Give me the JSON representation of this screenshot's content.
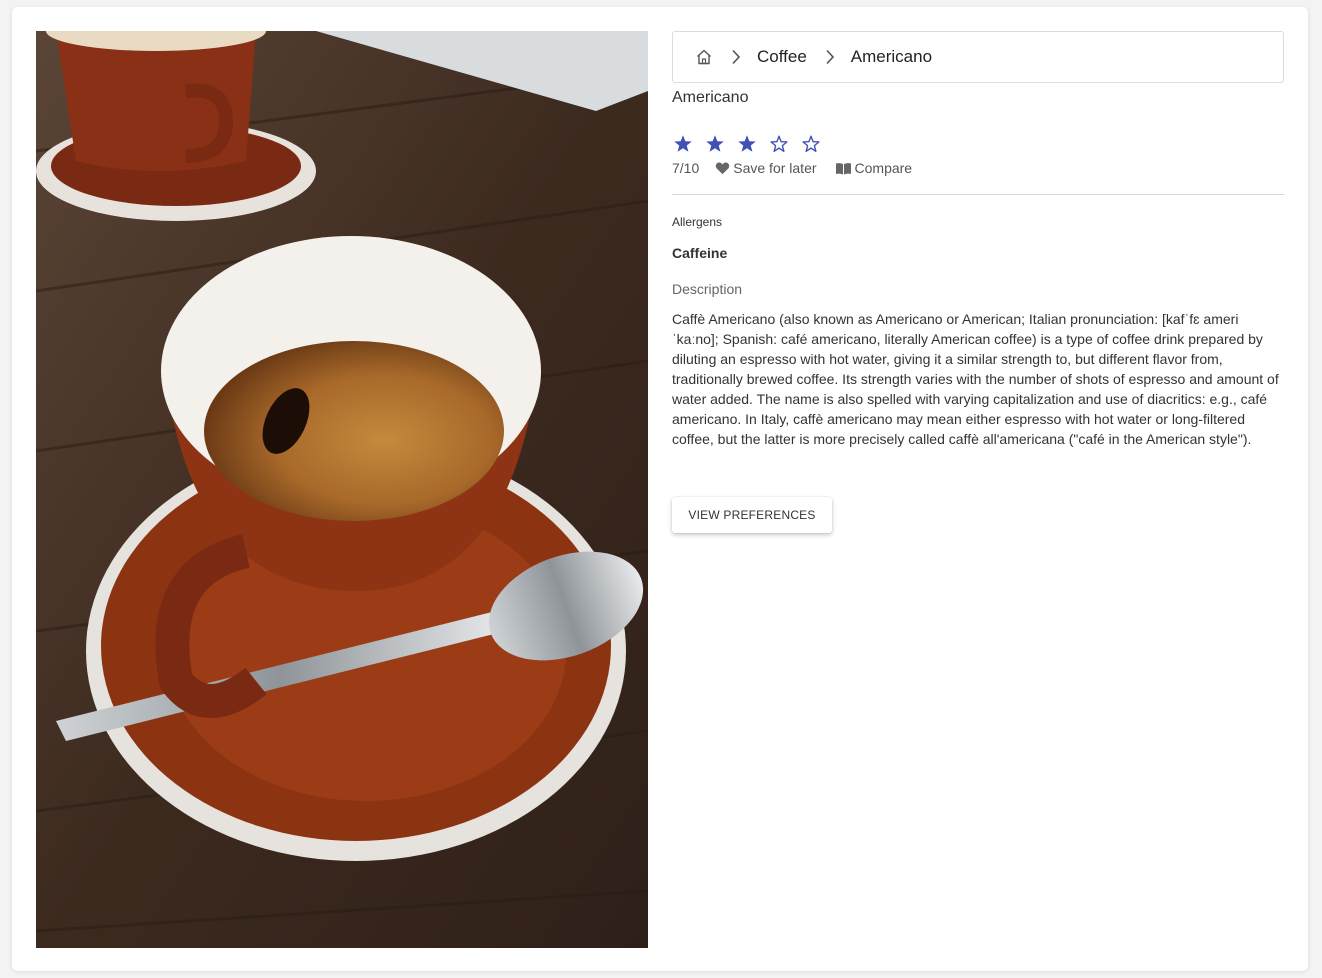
{
  "breadcrumb": {
    "home_icon": "home-icon",
    "items": [
      "Coffee",
      "Americano"
    ]
  },
  "product": {
    "title": "Americano",
    "rating": {
      "filled": 3,
      "max": 5,
      "score_text": "7/10",
      "star_color": "#3f51b5"
    },
    "save_label": "Save for later",
    "compare_label": "Compare",
    "allergens_label": "Allergens",
    "allergens_value": "Caffeine",
    "description_label": "Description",
    "description": "Caffè Americano (also known as Americano or American; Italian pronunciation: [kafˈfɛ ameriˈkaːno]; Spanish: café americano, literally American coffee) is a type of coffee drink prepared by diluting an espresso with hot water, giving it a similar strength to, but different flavor from, traditionally brewed coffee. Its strength varies with the number of shots of espresso and amount of water added. The name is also spelled with varying capitalization and use of diacritics: e.g., café americano. In Italy, caffè americano may mean either espresso with hot water or long-filtered coffee, but the latter is more precisely called caffè all'americana (\"café in the American style\").",
    "button_label": "View preferences"
  }
}
